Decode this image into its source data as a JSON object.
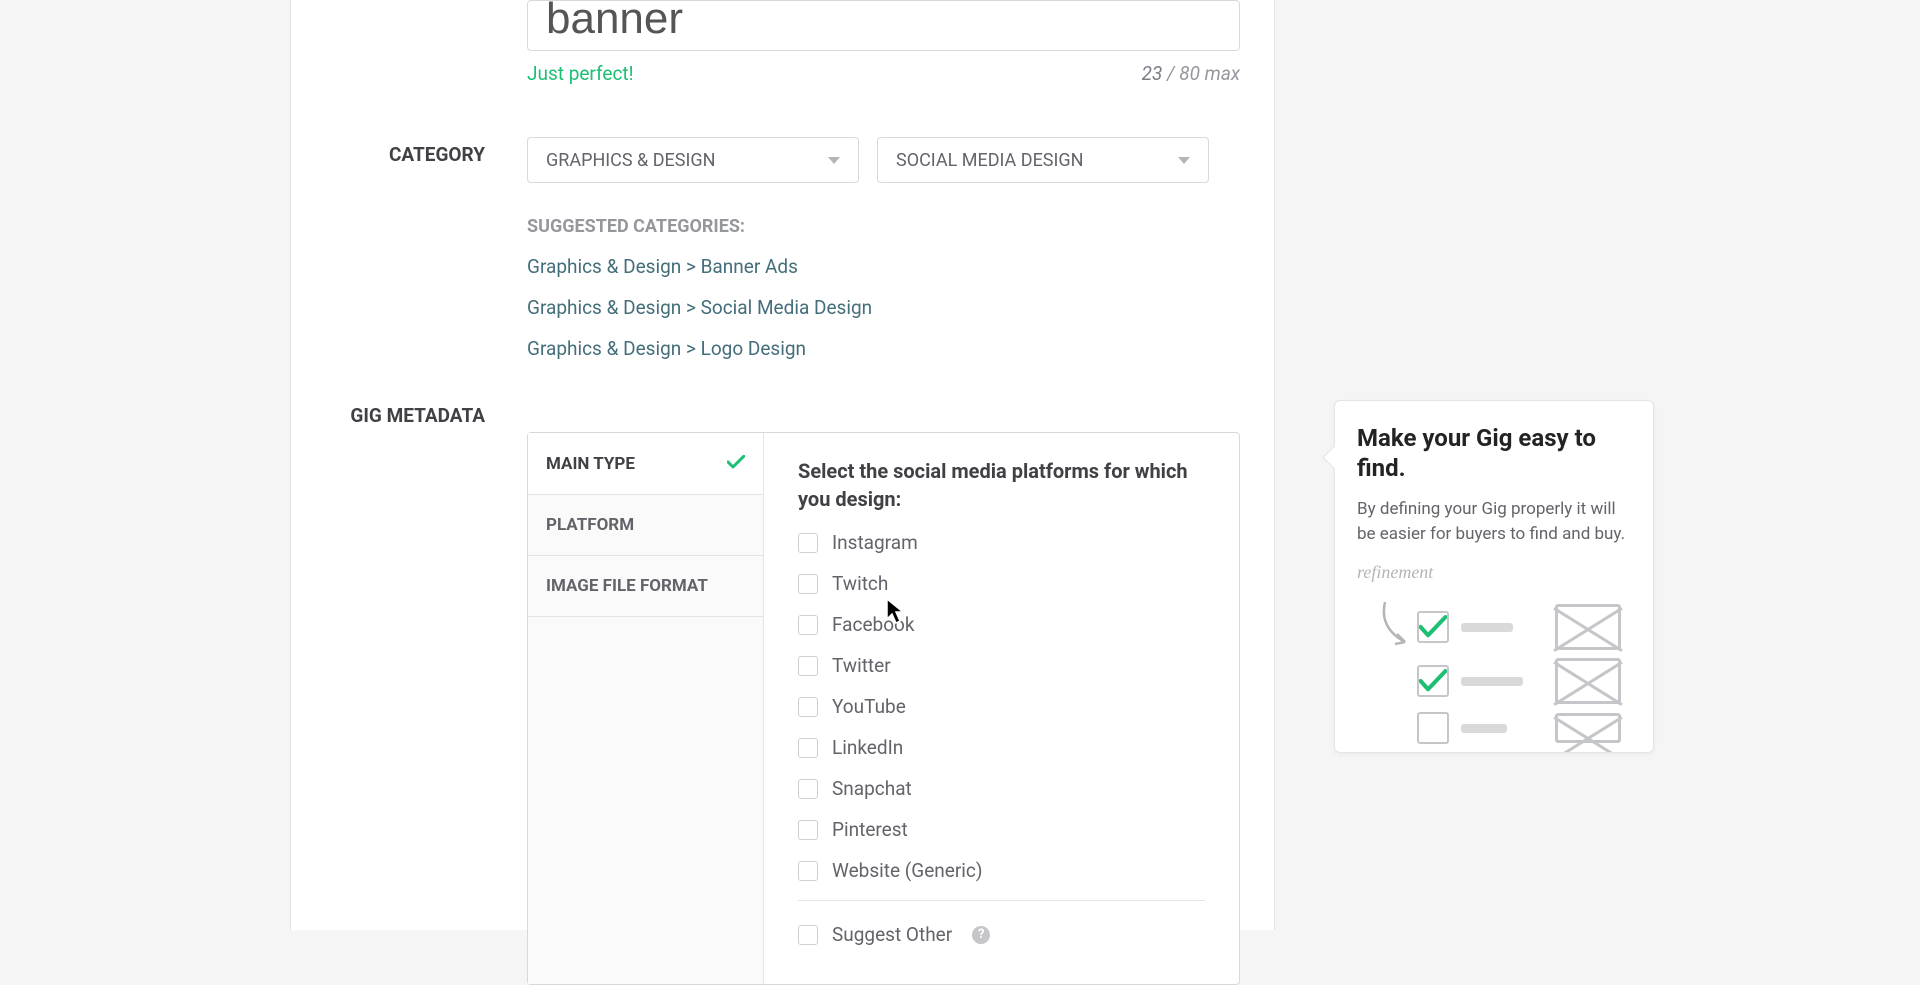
{
  "title": {
    "value": "banner",
    "success_msg": "Just perfect!",
    "count": "23",
    "max_label": " / 80 max"
  },
  "labels": {
    "category": "CATEGORY",
    "gig_metadata": "GIG METADATA"
  },
  "category": {
    "primary": "GRAPHICS & DESIGN",
    "secondary": "SOCIAL MEDIA DESIGN"
  },
  "suggested": {
    "title": "SUGGESTED CATEGORIES:",
    "items": [
      "Graphics & Design > Banner Ads",
      "Graphics & Design > Social Media Design",
      "Graphics & Design > Logo Design"
    ]
  },
  "metadata": {
    "tabs": [
      {
        "label": "MAIN TYPE",
        "checked": true
      },
      {
        "label": "PLATFORM",
        "checked": false
      },
      {
        "label": "IMAGE FILE FORMAT",
        "checked": false
      }
    ],
    "panel_title": "Select the social media platforms for which you design:",
    "platforms": [
      "Instagram",
      "Twitch",
      "Facebook",
      "Twitter",
      "YouTube",
      "LinkedIn",
      "Snapchat",
      "Pinterest",
      "Website (Generic)"
    ],
    "suggest_other": "Suggest Other"
  },
  "tip": {
    "title": "Make your Gig easy to find.",
    "body": "By defining your Gig properly it will be easier for buyers to find and buy.",
    "refinement": "refinement"
  }
}
